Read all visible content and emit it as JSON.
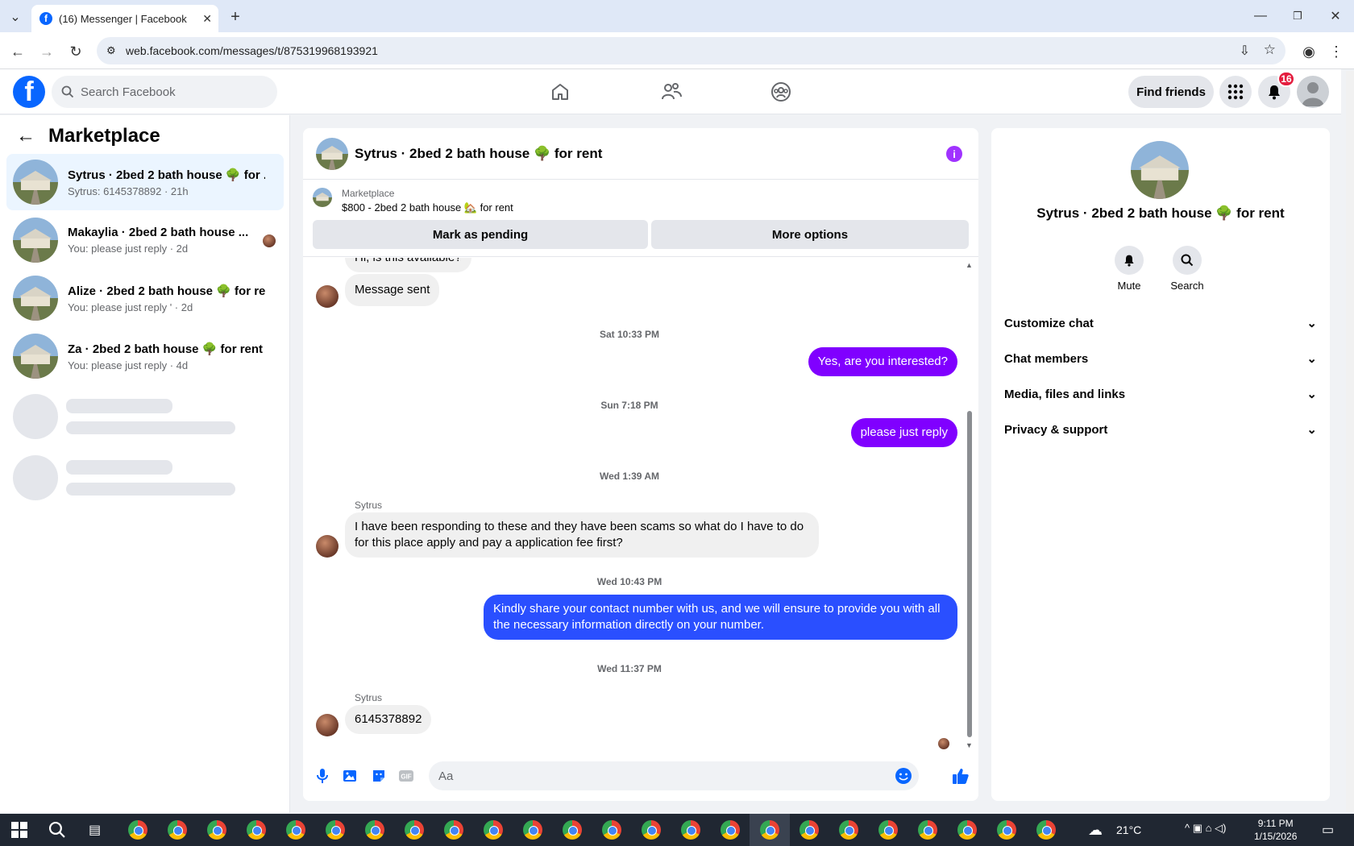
{
  "browser": {
    "tab_title": "(16) Messenger | Facebook",
    "url": "web.facebook.com/messages/t/875319968193921"
  },
  "fb": {
    "search_placeholder": "Search Facebook",
    "find_friends": "Find friends",
    "notif_count": "16"
  },
  "left": {
    "header": "Marketplace",
    "conversations": [
      {
        "title": "Sytrus · 2bed 2 bath house 🌳 for ...",
        "subtitle": "Sytrus: 6145378892 · 21h"
      },
      {
        "title": "Makaylia · 2bed 2 bath house ...",
        "subtitle": "You: please just reply · 2d"
      },
      {
        "title": "Alize · 2bed 2 bath house 🌳 for re...",
        "subtitle": "You: please just reply ' · 2d"
      },
      {
        "title": "Za · 2bed 2 bath house 🌳 for rent",
        "subtitle": "You: please just reply · 4d"
      }
    ]
  },
  "chat": {
    "title": "Sytrus · 2bed 2 bath house 🌳 for rent",
    "listing_label": "Marketplace",
    "listing_detail": "$800 - 2bed 2 bath house 🏡 for rent",
    "mark_pending": "Mark as pending",
    "more_options": "More options",
    "messages": {
      "partial_top": "Hi, is this available?",
      "m1": "Message sent",
      "ts1": "Sat 10:33 PM",
      "m2": "Yes, are you interested?",
      "ts2": "Sun 7:18 PM",
      "m3": "please just reply",
      "ts3": "Wed 1:39 AM",
      "sender1": "Sytrus",
      "m4": "I have been responding to these and they have been scams so what do I have to do for this place apply and pay a application fee first?",
      "ts4": "Wed 10:43 PM",
      "m5": "Kindly share your contact number with us, and we will ensure to provide you with all the necessary information directly on your number.",
      "ts5": "Wed 11:37 PM",
      "sender2": "Sytrus",
      "m6": "6145378892"
    },
    "input_placeholder": "Aa"
  },
  "right": {
    "title": "Sytrus · 2bed 2 bath house 🌳 for rent",
    "mute": "Mute",
    "search": "Search",
    "sections": [
      "Customize chat",
      "Chat members",
      "Media, files and links",
      "Privacy & support"
    ]
  },
  "taskbar": {
    "temp": "21°C",
    "time": "9:11 PM",
    "date": "1/15/2026"
  }
}
